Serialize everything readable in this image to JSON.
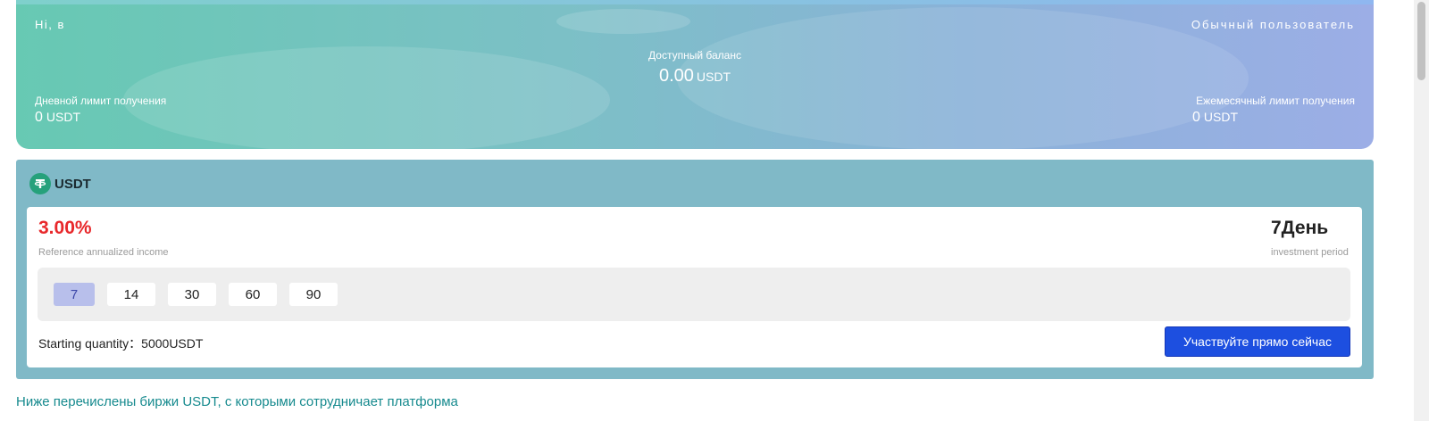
{
  "header": {
    "greeting": "Hi,  в",
    "user_type": "Обычный пользователь",
    "available_label": "Доступный баланс",
    "available_value": "0.00",
    "available_unit": "USDT",
    "daily_limit_label": "Дневной лимит получения",
    "daily_limit_value": "0",
    "daily_limit_unit": "USDT",
    "monthly_limit_label": "Ежемесячный лимит получения",
    "monthly_limit_value": "0",
    "monthly_limit_unit": "USDT"
  },
  "product": {
    "coin_name": "USDT",
    "coin_icon": "tether-icon",
    "rate": "3.00%",
    "rate_label": "Reference annualized income",
    "period": "7День",
    "period_label": "investment period",
    "options": [
      {
        "label": "7",
        "selected": true
      },
      {
        "label": "14",
        "selected": false
      },
      {
        "label": "30",
        "selected": false
      },
      {
        "label": "60",
        "selected": false
      },
      {
        "label": "90",
        "selected": false
      }
    ],
    "starting_quantity_label": "Starting quantity：",
    "starting_quantity_value": "5000USDT",
    "join_button": "Участвуйте прямо сейчас"
  },
  "footer_note": "Ниже перечислены биржи USDT, с которыми сотрудничает платформа",
  "colors": {
    "rate": "#e8282b",
    "button": "#1d4fe0",
    "selected_option": "#b8bfeb",
    "link_text": "#168a8e",
    "product_card_bg": "#80b9c7"
  }
}
